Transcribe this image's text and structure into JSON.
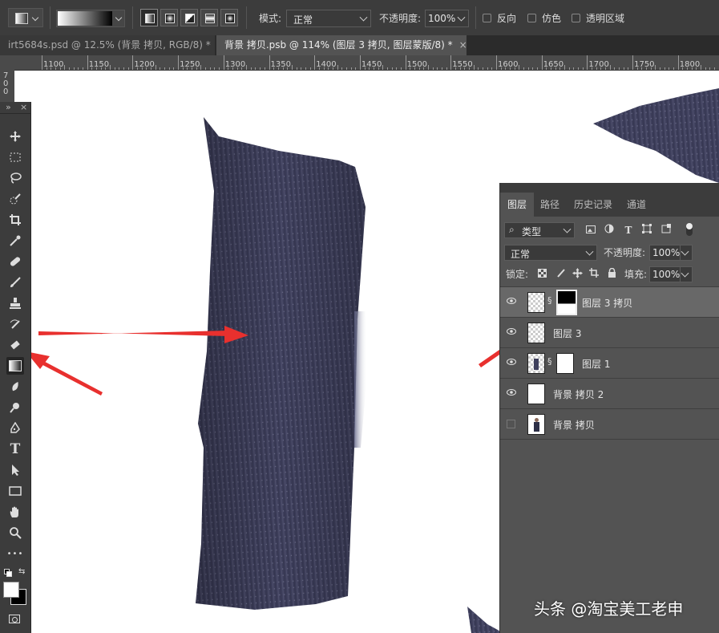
{
  "options_bar": {
    "mode_label": "模式:",
    "mode_value": "正常",
    "opacity_label": "不透明度:",
    "opacity_value": "100%",
    "reverse_label": "反向",
    "dither_label": "仿色",
    "transparency_label": "透明区域"
  },
  "tabs": [
    {
      "label": "irt5684s.psd @ 12.5% (背景 拷贝, RGB/8) *",
      "close": "×"
    },
    {
      "label": "背景 拷贝.psb @ 114% (图层 3 拷贝, 图层蒙版/8) *",
      "close": "×"
    }
  ],
  "ruler": {
    "ticks": [
      "1100",
      "1150",
      "1200",
      "1250",
      "1300",
      "1350",
      "1400",
      "1450",
      "1500",
      "1550",
      "1600",
      "1650",
      "1700",
      "1750",
      "1800"
    ],
    "vertical": [
      "7",
      "0",
      "0"
    ]
  },
  "toolbox": {
    "collapse": "»",
    "close": "×",
    "tools": [
      "move-tool",
      "marquee-tool",
      "lasso-tool",
      "quick-select-tool",
      "crop-tool",
      "eyedropper-tool",
      "healing-brush-tool",
      "brush-tool",
      "clone-stamp-tool",
      "history-brush-tool",
      "eraser-tool",
      "gradient-tool",
      "blur-tool",
      "dodge-tool",
      "pen-tool",
      "type-tool",
      "path-select-tool",
      "shape-tool",
      "hand-tool",
      "zoom-tool",
      "more-tools"
    ],
    "type_glyph": "T",
    "more_glyph": "•••"
  },
  "layers_panel": {
    "tabs": [
      "图层",
      "路径",
      "历史记录",
      "通道"
    ],
    "filter_label": "类型",
    "blend_mode": "正常",
    "opacity_label": "不透明度:",
    "opacity_value": "100%",
    "lock_label": "锁定:",
    "fill_label": "填充:",
    "fill_value": "100%",
    "filter_type_glyph": "T",
    "layers": [
      {
        "name": "图层 3 拷贝",
        "visible": true,
        "selected": true
      },
      {
        "name": "图层 3",
        "visible": true,
        "selected": false
      },
      {
        "name": "图层 1",
        "visible": true,
        "selected": false
      },
      {
        "name": "背景 拷贝 2",
        "visible": true,
        "selected": false
      },
      {
        "name": "背景 拷贝",
        "visible": false,
        "selected": false
      }
    ]
  },
  "watermark": "头条 @淘宝美工老申",
  "colors": {
    "fabric": "#3e3f5c",
    "arrow": "#e8302e"
  }
}
